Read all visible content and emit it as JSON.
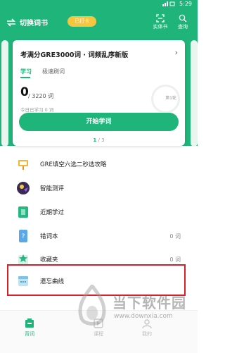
{
  "status_bar": {
    "time": "5:29"
  },
  "header": {
    "switch_label": "切换词书",
    "checkin_label": "已打卡",
    "tools": [
      {
        "label": "实体书",
        "icon": "scan-icon"
      },
      {
        "label": "查询",
        "icon": "search-icon"
      }
    ]
  },
  "card": {
    "book_title": "考满分GRE3000词 · 词频乱序新版",
    "tabs": [
      {
        "label": "学习",
        "active": true
      },
      {
        "label": "极速刷词",
        "active": false
      }
    ],
    "learned_count": "0",
    "total_words": "/ 3220 词",
    "today_text": "今日已学习 0 词",
    "round_label": "第1轮",
    "start_button": "开始学词",
    "pager_current": "1",
    "pager_total": "/ 3"
  },
  "menu": [
    {
      "label": "GRE填空六选二秒选攻略",
      "value": "",
      "icon": "strategy-icon"
    },
    {
      "label": "智能测评",
      "value": "",
      "icon": "assessment-icon"
    },
    {
      "label": "近期学过",
      "value": "",
      "icon": "recent-icon"
    },
    {
      "label": "错词本",
      "value": "0 词",
      "icon": "mistake-book-icon"
    },
    {
      "label": "收藏夹",
      "value": "0 词",
      "icon": "favorites-icon"
    },
    {
      "label": "遗忘曲线",
      "value": "",
      "icon": "forgetting-curve-icon"
    }
  ],
  "bottom_nav": [
    {
      "label": "背词",
      "active": true
    },
    {
      "label": "课程",
      "active": false
    },
    {
      "label": "我的",
      "active": false
    }
  ],
  "watermark": {
    "text": "当下软件园",
    "url": "www.downxia.com"
  },
  "colors": {
    "accent": "#1fb57a",
    "checkin": "#f6c640",
    "highlight": "#d9202a"
  }
}
